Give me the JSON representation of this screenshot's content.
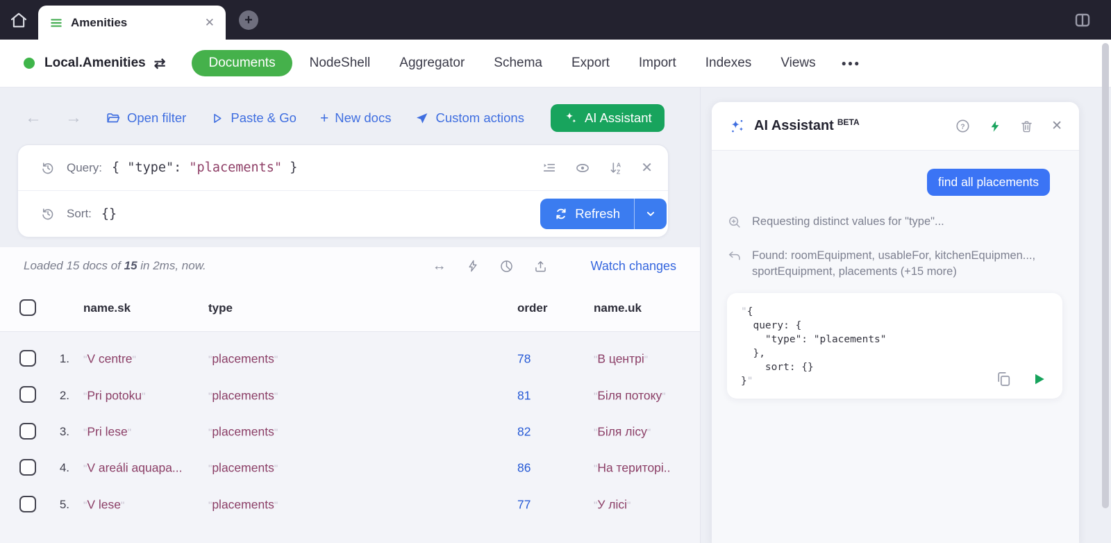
{
  "glyphs": {
    "plus": "+",
    "back": "←",
    "forward": "→",
    "swap": "⇄",
    "close": "✕",
    "more": "●●●",
    "arrows_h": "↔"
  },
  "topbar": {
    "tab_title": "Amenities"
  },
  "connbar": {
    "connection": "Local.Amenities",
    "nav": [
      {
        "label": "Documents"
      },
      {
        "label": "NodeShell"
      },
      {
        "label": "Aggregator"
      },
      {
        "label": "Schema"
      },
      {
        "label": "Export"
      },
      {
        "label": "Import"
      },
      {
        "label": "Indexes"
      },
      {
        "label": "Views"
      }
    ]
  },
  "toolbar": {
    "open_filter": "Open filter",
    "paste_go": "Paste & Go",
    "new_docs": "New docs",
    "custom_actions": "Custom actions",
    "ai_assistant": "AI Assistant"
  },
  "query": {
    "label": "Query:",
    "code_head": "{ \"type\": ",
    "code_value": "\"placements\"",
    "code_tail": " }"
  },
  "sort": {
    "label": "Sort:",
    "value": "{}",
    "refresh": "Refresh"
  },
  "status": {
    "prefix": "Loaded 15 docs of ",
    "count": "15",
    "suffix": " in 2ms, now.",
    "watch": "Watch changes"
  },
  "table": {
    "quote": "\"",
    "headers": {
      "name_sk": "name.sk",
      "type": "type",
      "order": "order",
      "name_uk": "name.uk"
    },
    "rows": [
      {
        "num": "1.",
        "name_sk": "V centre",
        "type": "placements",
        "order": "78",
        "name_uk": "В центрі"
      },
      {
        "num": "2.",
        "name_sk": "Pri potoku",
        "type": "placements",
        "order": "81",
        "name_uk": "Біля потоку"
      },
      {
        "num": "3.",
        "name_sk": "Pri lese",
        "type": "placements",
        "order": "82",
        "name_uk": "Біля лісу"
      },
      {
        "num": "4.",
        "name_sk": "V areáli aquapa...",
        "type": "placements",
        "order": "86",
        "name_uk": "На територі.."
      },
      {
        "num": "5.",
        "name_sk": "V lese",
        "type": "placements",
        "order": "77",
        "name_uk": "У лісі"
      }
    ]
  },
  "ai": {
    "title": "AI Assistant",
    "beta": "BETA",
    "user_query": "find all placements",
    "step1": "Requesting distinct values for \"type\"...",
    "step2_line1": "Found: roomEquipment, usableFor, kitchenEquipmen...,",
    "step2_line2": "sportEquipment, placements (+15 more)",
    "code_quote": "\"",
    "code": "{\n  query: {\n    \"type\": \"placements\"\n  },\n    sort: {}\n}"
  },
  "colors": {
    "topbar_bg": "#23222f",
    "active_tab_green": "#45b14b",
    "ai_button_green": "#18a45d",
    "link_blue": "#3f6ee0",
    "refresh_blue": "#3b7cf0",
    "user_pill_blue": "#3b74f5",
    "string_value": "#8b3e66",
    "order_value": "#2458d5",
    "status_green_dot": "#3fb54a"
  }
}
